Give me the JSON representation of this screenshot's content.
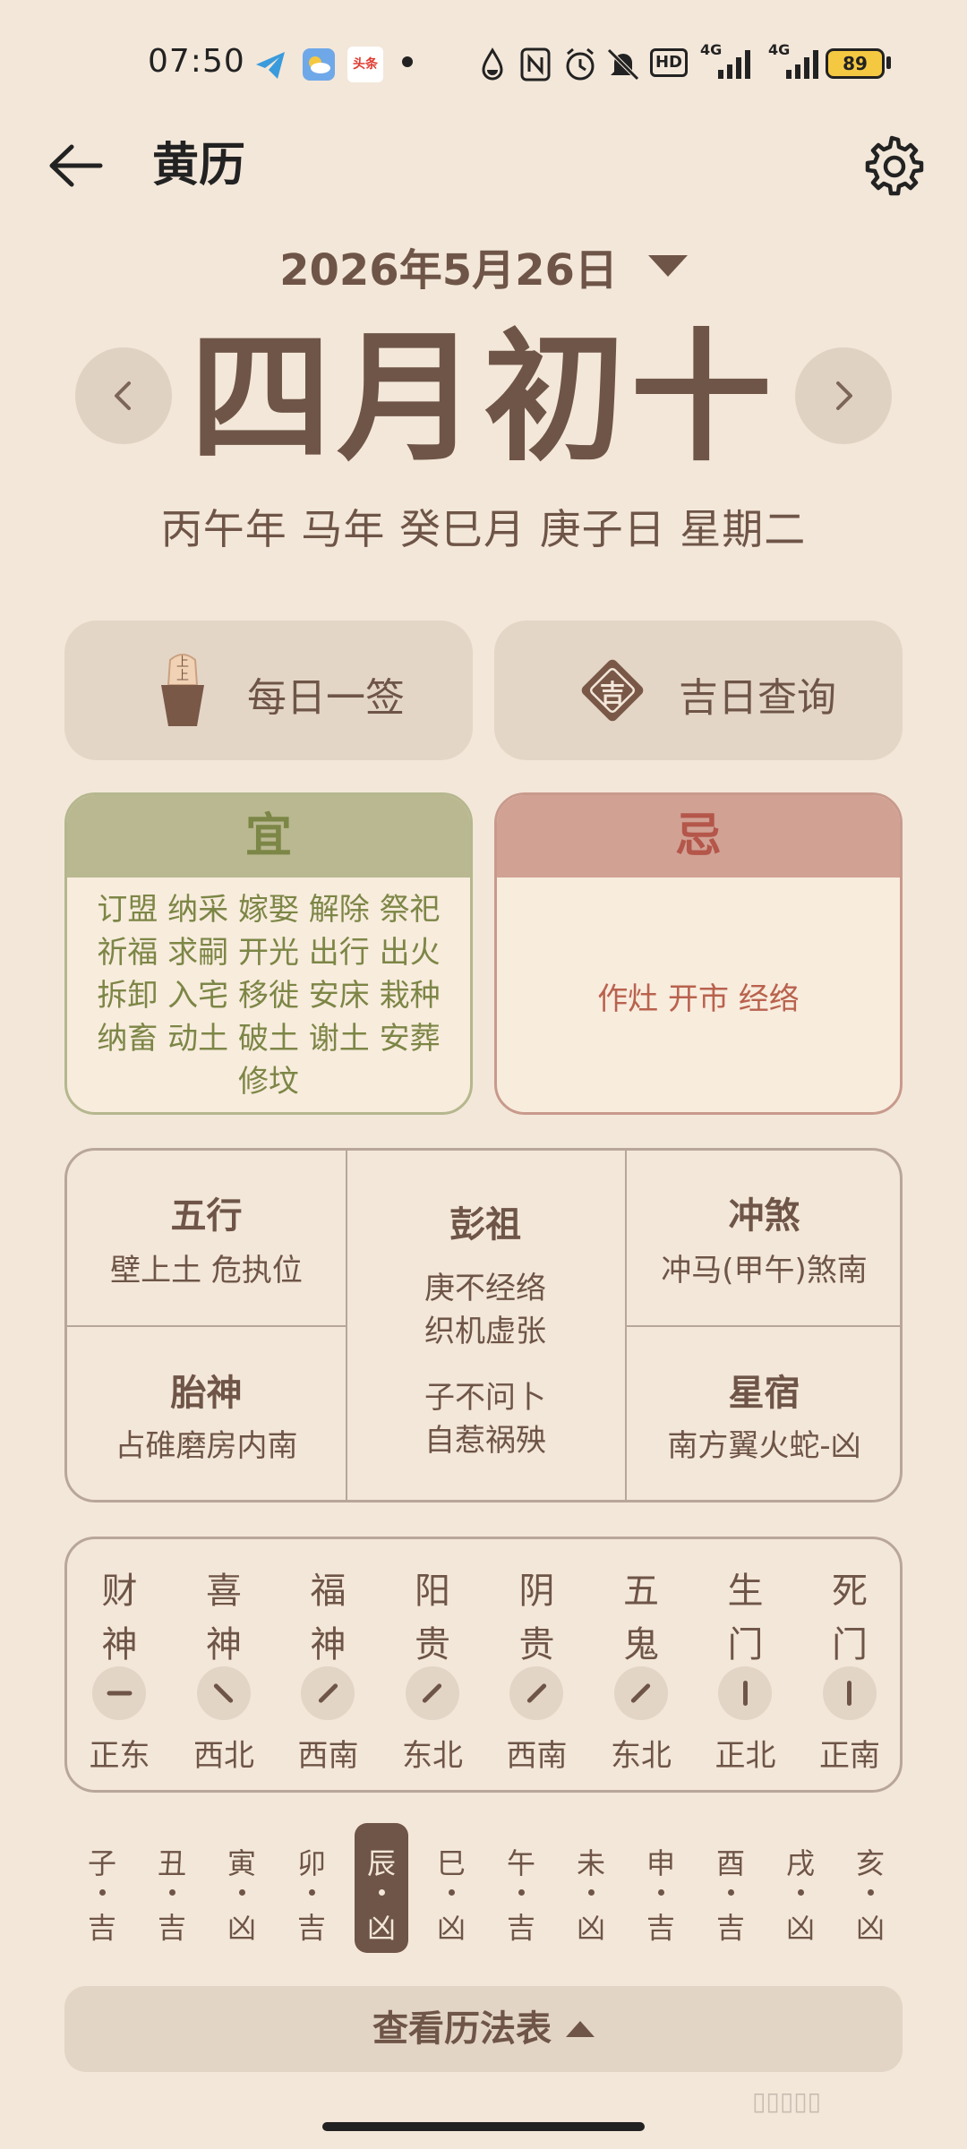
{
  "status_bar": {
    "time": "07:50",
    "app_badge": "头条",
    "signal_label_1": "4G",
    "signal_label_2": "4G",
    "hd_label": "HD",
    "battery": "89"
  },
  "header": {
    "title": "黄历"
  },
  "date": {
    "selected": "2026年5月26日"
  },
  "lunar": {
    "date": "四月初十",
    "ganzhi": "丙午年 马年 癸巳月 庚子日 星期二"
  },
  "actions": {
    "daily_sign": "每日一签",
    "daily_sign_chars": "上上",
    "lucky_day": "吉日查询",
    "lucky_char": "吉"
  },
  "yi": {
    "title": "宜",
    "lines": [
      "订盟 纳采 嫁娶 解除 祭祀",
      "祈福 求嗣 开光 出行 出火",
      "拆卸 入宅 移徙 安床 栽种",
      "纳畜 动土 破土 谢土 安葬",
      "修坟"
    ]
  },
  "ji": {
    "title": "忌",
    "text": "作灶 开市 经络"
  },
  "info": {
    "wuxing": {
      "title": "五行",
      "text": "壁上土 危执位"
    },
    "pengzu": {
      "title": "彭祖",
      "line1": "庚不经络",
      "line2": "织机虚张",
      "line3": "子不问卜",
      "line4": "自惹祸殃"
    },
    "chongsha": {
      "title": "冲煞",
      "text": "冲马(甲午)煞南"
    },
    "taishen": {
      "title": "胎神",
      "text": "占碓磨房内南"
    },
    "xingxiu": {
      "title": "星宿",
      "text": "南方翼火蛇-凶"
    }
  },
  "gods": [
    {
      "name1": "财",
      "name2": "神",
      "direction": "正东",
      "angle": 90
    },
    {
      "name1": "喜",
      "name2": "神",
      "direction": "西北",
      "angle": -45
    },
    {
      "name1": "福",
      "name2": "神",
      "direction": "西南",
      "angle": -135
    },
    {
      "name1": "阳",
      "name2": "贵",
      "direction": "东北",
      "angle": 45
    },
    {
      "name1": "阴",
      "name2": "贵",
      "direction": "西南",
      "angle": -135
    },
    {
      "name1": "五",
      "name2": "鬼",
      "direction": "东北",
      "angle": 45
    },
    {
      "name1": "生",
      "name2": "门",
      "direction": "正北",
      "angle": 0
    },
    {
      "name1": "死",
      "name2": "门",
      "direction": "正南",
      "angle": 180
    }
  ],
  "hours": [
    {
      "branch": "子",
      "status": "吉"
    },
    {
      "branch": "丑",
      "status": "吉"
    },
    {
      "branch": "寅",
      "status": "凶"
    },
    {
      "branch": "卯",
      "status": "吉"
    },
    {
      "branch": "辰",
      "status": "凶",
      "selected": true
    },
    {
      "branch": "巳",
      "status": "凶"
    },
    {
      "branch": "午",
      "status": "吉"
    },
    {
      "branch": "未",
      "status": "凶"
    },
    {
      "branch": "申",
      "status": "吉"
    },
    {
      "branch": "酉",
      "status": "吉"
    },
    {
      "branch": "戌",
      "status": "凶"
    },
    {
      "branch": "亥",
      "status": "凶"
    }
  ],
  "footer": {
    "table_button": "查看历法表"
  },
  "colors": {
    "background": "#f3e7d9",
    "primary_text": "#6e5547",
    "yi_accent": "#7c8646",
    "ji_accent": "#b4564a"
  }
}
